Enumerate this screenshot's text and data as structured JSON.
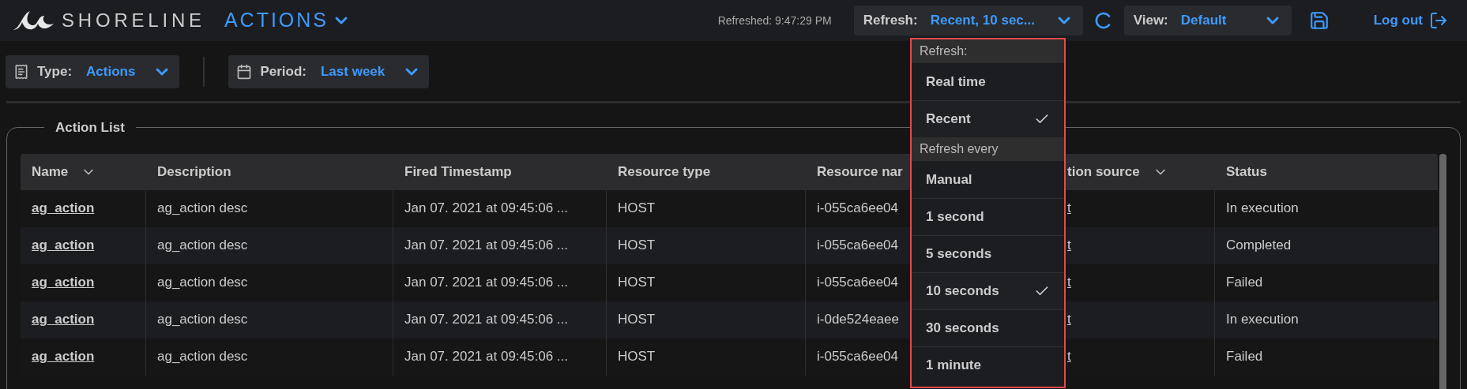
{
  "header": {
    "logo": "SHORELINE",
    "app_menu": "ACTIONS",
    "refreshed": "Refreshed: 9:47:29 PM",
    "refresh": {
      "label": "Refresh:",
      "value": "Recent, 10 sec..."
    },
    "view": {
      "label": "View:",
      "value": "Default"
    },
    "logout": "Log out"
  },
  "filters": [
    {
      "kind": "type",
      "label": "Type:",
      "value": "Actions"
    },
    {
      "kind": "period",
      "label": "Period:",
      "value": "Last week"
    }
  ],
  "action_list": {
    "title": "Action List",
    "columns": [
      {
        "label": "Name",
        "sort_menu": true
      },
      {
        "label": "Description",
        "sort_menu": false
      },
      {
        "label": "Fired Timestamp",
        "sort_menu": false
      },
      {
        "label": "Resource type",
        "sort_menu": false
      },
      {
        "label": "Resource nar",
        "sort_menu": false
      },
      {
        "label": "tion source",
        "sort_menu": true
      },
      {
        "label": "Status",
        "sort_menu": false
      }
    ],
    "rows": [
      [
        "ag_action",
        "ag_action desc",
        "Jan 07. 2021 at 09:45:06 ...",
        "HOST",
        "i-055ca6ee04",
        "t",
        "In execution"
      ],
      [
        "ag_action",
        "ag_action desc",
        "Jan 07. 2021 at 09:45:06 ...",
        "HOST",
        "i-055ca6ee04",
        "t",
        "Completed"
      ],
      [
        "ag_action",
        "ag_action desc",
        "Jan 07. 2021 at 09:45:06 ...",
        "HOST",
        "i-055ca6ee04",
        "t",
        "Failed"
      ],
      [
        "ag_action",
        "ag_action desc",
        "Jan 07. 2021 at 09:45:06 ...",
        "HOST",
        "i-0de524eaee",
        "t",
        "In execution"
      ],
      [
        "ag_action",
        "ag_action desc",
        "Jan 07. 2021 at 09:45:06 ...",
        "HOST",
        "i-055ca6ee04",
        "t",
        "Failed"
      ]
    ]
  },
  "refresh_menu": {
    "sections": [
      {
        "heading": "Refresh:",
        "items": [
          {
            "label": "Real time",
            "selected": false
          },
          {
            "label": "Recent",
            "selected": true
          }
        ]
      },
      {
        "heading": "Refresh every",
        "items": [
          {
            "label": "Manual",
            "selected": false
          },
          {
            "label": "1 second",
            "selected": false
          },
          {
            "label": "5 seconds",
            "selected": false
          },
          {
            "label": "10 seconds",
            "selected": true
          },
          {
            "label": "30 seconds",
            "selected": false
          },
          {
            "label": "1 minute",
            "selected": false
          }
        ]
      }
    ]
  }
}
